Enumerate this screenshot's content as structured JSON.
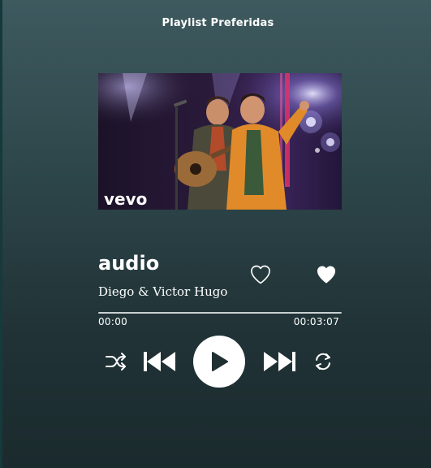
{
  "header": {
    "title": "Playlist Preferidas"
  },
  "cover": {
    "brand": "vevo",
    "icon": "album-cover-image"
  },
  "track": {
    "title": "audio",
    "artist": "Diego & Victor Hugo"
  },
  "actions": {
    "like_outline_icon": "heart-outline-icon",
    "like_filled_icon": "heart-filled-icon"
  },
  "progress": {
    "current_time": "00:00",
    "total_time": "00:03:07",
    "fraction": 0
  },
  "controls": {
    "shuffle_icon": "shuffle-icon",
    "previous_icon": "skip-previous-icon",
    "play_icon": "play-icon",
    "next_icon": "skip-next-icon",
    "repeat_icon": "repeat-icon"
  },
  "colors": {
    "background_top": "#3e5a5f",
    "background_bottom": "#1a2a2d",
    "foreground": "#ffffff"
  }
}
